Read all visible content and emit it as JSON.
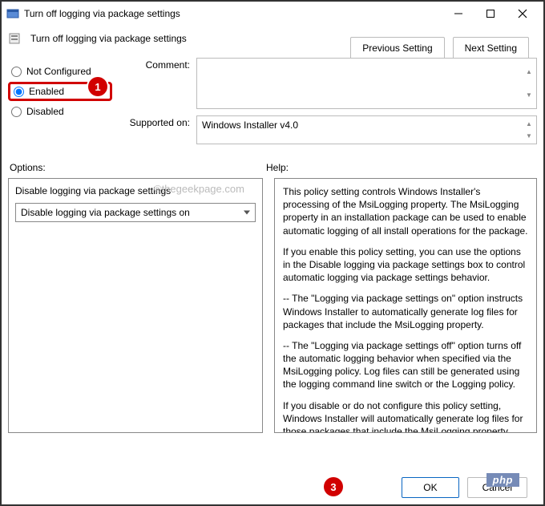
{
  "window": {
    "title": "Turn off logging via package settings",
    "subtitle": "Turn off logging via package settings"
  },
  "nav": {
    "prev": "Previous Setting",
    "next": "Next Setting"
  },
  "radios": {
    "not_configured": "Not Configured",
    "enabled": "Enabled",
    "disabled": "Disabled"
  },
  "labels": {
    "comment": "Comment:",
    "supported_on": "Supported on:",
    "options": "Options:",
    "help": "Help:"
  },
  "supported_text": "Windows Installer v4.0",
  "options_panel": {
    "title": "Disable logging via package settings",
    "select_value": "Disable logging via package settings on"
  },
  "help_paragraphs": {
    "p1": "This policy setting controls Windows Installer's processing of the MsiLogging property. The MsiLogging property in an installation package can be used to enable automatic logging of all install operations for the package.",
    "p2": "If you enable this policy setting, you can use the options in the Disable logging via package settings box to control automatic logging via package settings behavior.",
    "p3": "-- The \"Logging via package settings on\" option instructs Windows Installer to automatically generate log files for packages that include the MsiLogging property.",
    "p4": "-- The \"Logging via package settings off\" option turns off the automatic logging behavior when specified via the MsiLogging policy. Log files can still be generated using the logging command line switch or the Logging policy.",
    "p5": "If you disable or do not configure this policy setting, Windows Installer will automatically generate log files for those packages that include the MsiLogging property."
  },
  "footer": {
    "ok": "OK",
    "cancel": "Cancel"
  },
  "callouts": {
    "c1": "1",
    "c3": "3"
  },
  "watermark": "©thegeekpage.com",
  "badge": "php"
}
